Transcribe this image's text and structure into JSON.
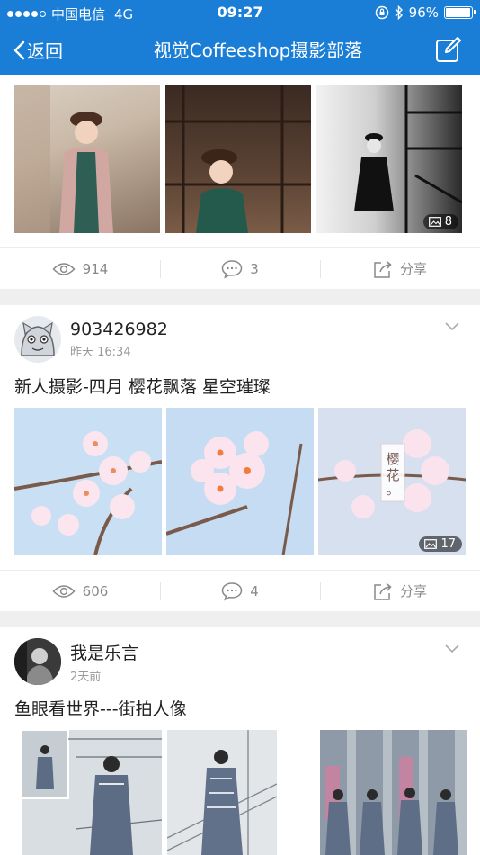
{
  "status_bar": {
    "carrier": "中国电信",
    "network": "4G",
    "time": "09:27",
    "battery": "96%",
    "battery_level": 0.96
  },
  "nav": {
    "back_label": "返回",
    "title": "视觉Coffeeshop摄影部落"
  },
  "posts": [
    {
      "image_count": "8",
      "views": "914",
      "comments": "3",
      "share": "分享"
    },
    {
      "username": "903426982",
      "time": "昨天 16:34",
      "title": "新人摄影-四月 樱花飘落 星空璀璨",
      "image_count": "17",
      "views": "606",
      "comments": "4",
      "share": "分享",
      "overlay_text": "樱花。"
    },
    {
      "username": "我是乐言",
      "time": "2天前",
      "title": "鱼眼看世界---街拍人像"
    }
  ],
  "colors": {
    "nav": "#1a7ed6",
    "muted": "#888888",
    "separator": "#efefef"
  },
  "icons": [
    "back-chevron-icon",
    "compose-icon",
    "eye-icon",
    "comment-icon",
    "share-icon",
    "chevron-down-icon",
    "image-count-icon",
    "bluetooth-icon",
    "lock-rotation-icon"
  ]
}
